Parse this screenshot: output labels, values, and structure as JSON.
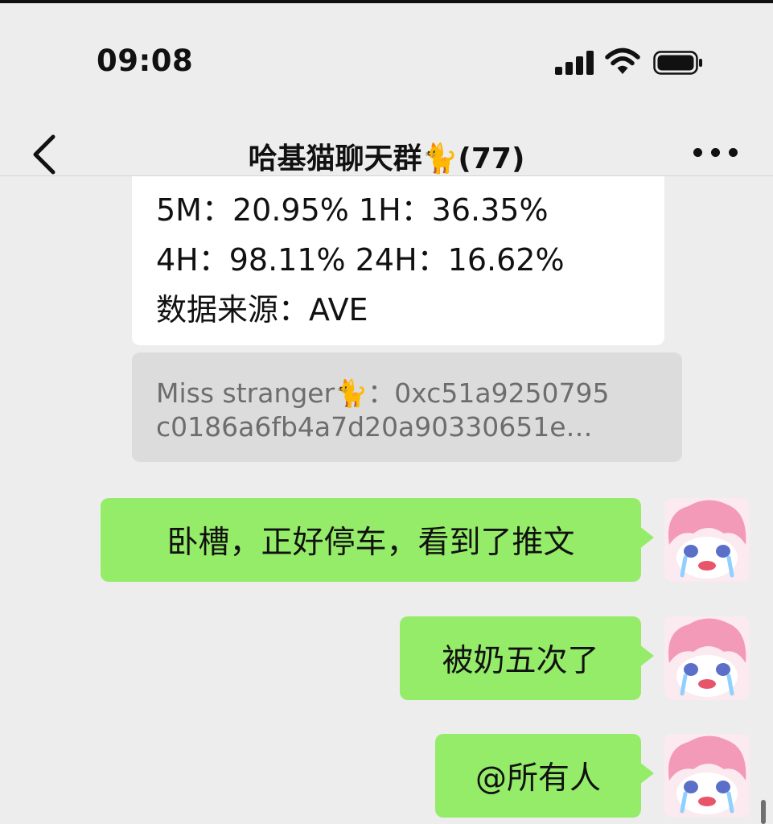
{
  "status_bar": {
    "time": "09:08"
  },
  "nav": {
    "title": "哈基猫聊天群",
    "title_emoji": "🐈",
    "member_count": "(77)"
  },
  "card": {
    "line1": "5M：20.95%   1H：36.35%",
    "line2": "4H：98.11%   24H：16.62%",
    "line3": "数据来源：AVE"
  },
  "quote": {
    "sender": "Miss stranger🐈：",
    "text1": "0xc51a9250795",
    "text2": "c0186a6fb4a7d20a90330651e…"
  },
  "messages": [
    {
      "text": "卧槽，正好停车，看到了推文"
    },
    {
      "text": "被奶五次了"
    },
    {
      "text": "@所有人"
    }
  ],
  "colors": {
    "bubble": "#95ec69",
    "background": "#ededed",
    "quote_bg": "#dcdcdc"
  },
  "icons": [
    "cellular-signal-icon",
    "wifi-icon",
    "battery-icon",
    "back-chevron-icon",
    "more-dots-icon"
  ]
}
